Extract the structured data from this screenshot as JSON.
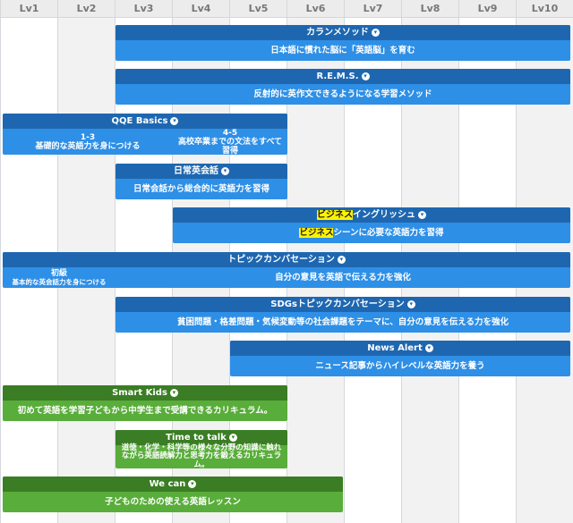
{
  "levels": [
    "Lv1",
    "Lv2",
    "Lv3",
    "Lv4",
    "Lv5",
    "Lv6",
    "Lv7",
    "Lv8",
    "Lv9",
    "Lv10"
  ],
  "courses": {
    "karan": {
      "title": "カランメソッド",
      "desc": "日本語に慣れた脳に「英語脳」を育む"
    },
    "rems": {
      "title": "R.E.M.S.",
      "desc": "反射的に英作文できるようになる学習メソッド"
    },
    "qqe": {
      "title": "QQE Basics",
      "part1_level": "1-3",
      "part1_desc": "基礎的な英語力を身につける",
      "part2_level": "4-5",
      "part2_desc": "高校卒業までの文法をすべて習得"
    },
    "nichijo": {
      "title": "日常英会話",
      "desc": "日常会話から総合的に英語力を習得"
    },
    "business": {
      "title_hl": "ビジネス",
      "title_rest": "イングリッシュ",
      "desc_hl": "ビジネス",
      "desc_rest": "シーンに必要な英語力を習得"
    },
    "topic": {
      "title": "トピックカンバセーション",
      "beginner_label": "初級",
      "beginner_desc": "基本的な英会話力を身につける",
      "desc": "自分の意見を英語で伝える力を強化"
    },
    "sdgs": {
      "title": "SDGsトピックカンバセーション",
      "desc": "貧困問題・格差問題・気候変動等の社会課題をテーマに、自分の意見を伝える力を強化"
    },
    "news": {
      "title": "News Alert",
      "desc": "ニュース記事からハイレベルな英語力を養う"
    },
    "kids": {
      "title": "Smart Kids",
      "desc": "初めて英語を学習子どもから中学生まで受講できるカリキュラム。"
    },
    "ttt": {
      "title": "Time to talk",
      "desc": "道徳・化学・科学等の様々な分野の知識に触れながら英語読解力と思考力を鍛えるカリキュラム。"
    },
    "wecan": {
      "title": "We can",
      "desc": "子どものための使える英語レッスン"
    }
  },
  "colors": {
    "blue_body": "#2e8fe6",
    "blue_header": "#1e67b0",
    "green_body": "#59ad3a",
    "green_header": "#3a7d24",
    "highlight": "#fff200"
  },
  "icons": {
    "info": "info-circle-icon"
  }
}
